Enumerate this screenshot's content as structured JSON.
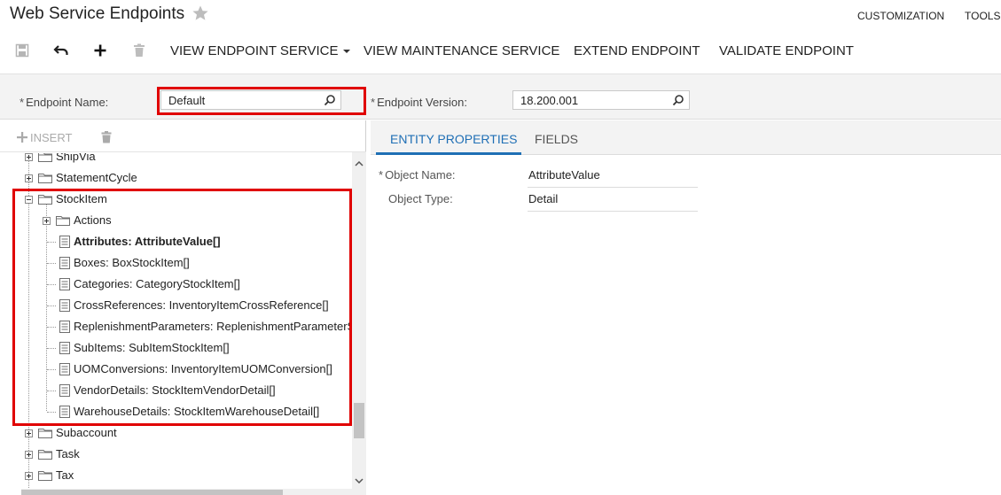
{
  "header": {
    "title": "Web Service Endpoints",
    "links": [
      "CUSTOMIZATION",
      "TOOLS"
    ]
  },
  "toolbar": {
    "icons": [
      "save-icon",
      "undo-icon",
      "add-icon",
      "delete-icon"
    ],
    "view_endpoint_service": "VIEW ENDPOINT SERVICE",
    "view_maintenance_service": "VIEW MAINTENANCE SERVICE",
    "extend_endpoint": "EXTEND ENDPOINT",
    "validate_endpoint": "VALIDATE ENDPOINT"
  },
  "form": {
    "endpoint_name_label": "Endpoint Name:",
    "endpoint_name_value": "Default",
    "endpoint_version_label": "Endpoint Version:",
    "endpoint_version_value": "18.200.001",
    "required_mark": "*"
  },
  "tree": {
    "insert_label": "INSERT",
    "items": [
      {
        "label": "ShipVia"
      },
      {
        "label": "StatementCycle"
      },
      {
        "label": "StockItem"
      },
      {
        "label": "Actions"
      },
      {
        "label": "Attributes: AttributeValue[]"
      },
      {
        "label": "Boxes: BoxStockItem[]"
      },
      {
        "label": "Categories: CategoryStockItem[]"
      },
      {
        "label": "CrossReferences: InventoryItemCrossReference[]"
      },
      {
        "label": "ReplenishmentParameters: ReplenishmentParameterStockItem[]"
      },
      {
        "label": "SubItems: SubItemStockItem[]"
      },
      {
        "label": "UOMConversions: InventoryItemUOMConversion[]"
      },
      {
        "label": "VendorDetails: StockItemVendorDetail[]"
      },
      {
        "label": "WarehouseDetails: StockItemWarehouseDetail[]"
      },
      {
        "label": "Subaccount"
      },
      {
        "label": "Task"
      },
      {
        "label": "Tax"
      }
    ]
  },
  "details": {
    "tabs": [
      "ENTITY PROPERTIES",
      "FIELDS"
    ],
    "object_name_label": "Object Name:",
    "object_name_value": "AttributeValue",
    "object_type_label": "Object Type:",
    "object_type_value": "Detail"
  },
  "colors": {
    "accent": "#1f6fb5",
    "highlight_frame": "#e00000"
  }
}
